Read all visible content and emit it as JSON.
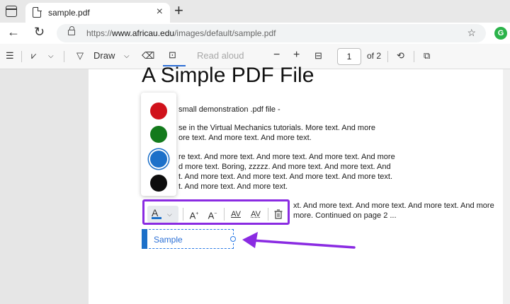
{
  "browser": {
    "tab_title": "sample.pdf",
    "tab_close": "×",
    "new_tab": "+",
    "url_prefix": "https://",
    "url_host": "www.africau.edu",
    "url_path": "/images/default/sample.pdf",
    "profile_initial": "G"
  },
  "pdf_toolbar": {
    "draw_label": "Draw",
    "read_aloud_label": "Read aloud",
    "zoom_out": "−",
    "zoom_in": "+",
    "page_current": "1",
    "page_total": "of 2"
  },
  "document": {
    "heading": "A Simple PDF File",
    "lines": [
      "small demonstration .pdf file -",
      "se in the Virtual Mechanics tutorials. More text. And more",
      "ore text. And more text. And more text.",
      "re text. And more text. And more text. And more text. And more",
      "d more text. Boring, zzzzz. And more text. And more text. And",
      "t. And more text. And more text. And more text. And more text.",
      "t. And more text. And more text.",
      "xt. And more text. And more text. And more text. And more",
      "more. Continued on page 2 ..."
    ]
  },
  "color_swatches": [
    {
      "name": "red",
      "color": "#d0121b"
    },
    {
      "name": "green",
      "color": "#137a1c"
    },
    {
      "name": "blue",
      "color": "#1c70c9",
      "selected": true
    },
    {
      "name": "black",
      "color": "#0d0d0d"
    }
  ],
  "text_toolbar": {
    "color_label": "A",
    "increase_font": "A",
    "decrease_font": "A",
    "increase_spacing": "AV",
    "decrease_spacing": "AV",
    "highlight_color": "#8a2be2"
  },
  "textbox": {
    "value": "Sample"
  },
  "annotation_arrow_color": "#8a2be2"
}
